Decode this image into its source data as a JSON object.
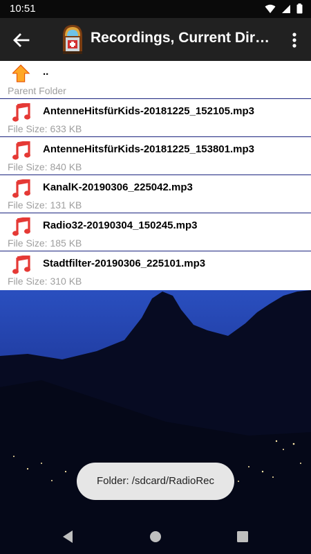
{
  "status": {
    "time": "10:51",
    "icons": [
      "wifi-icon",
      "signal-icon",
      "battery-icon"
    ]
  },
  "appbar": {
    "title": "Recordings, Current Dir:...",
    "back_icon": "arrow-back-icon",
    "app_icon": "jukebox-icon",
    "menu_icon": "more-vert-icon"
  },
  "parent": {
    "name": "..",
    "label": "Parent Folder",
    "icon": "up-arrow-icon"
  },
  "files": [
    {
      "name": "AntenneHitsfürKids-20181225_152105.mp3",
      "size": "File Size: 633 KB",
      "icon": "music-note-icon"
    },
    {
      "name": "AntenneHitsfürKids-20181225_153801.mp3",
      "size": "File Size: 840 KB",
      "icon": "music-note-icon"
    },
    {
      "name": "KanalK-20190306_225042.mp3",
      "size": "File Size: 131 KB",
      "icon": "music-note-icon"
    },
    {
      "name": "Radio32-20190304_150245.mp3",
      "size": "File Size: 185 KB",
      "icon": "music-note-icon"
    },
    {
      "name": "Stadtfilter-20190306_225101.mp3",
      "size": "File Size: 310 KB",
      "icon": "music-note-icon"
    }
  ],
  "toast": {
    "text": "Folder: /sdcard/RadioRec"
  },
  "colors": {
    "appbar": "#212121",
    "divider": "#1a237e",
    "note": "#e53935",
    "arrow": "#ff9800",
    "sky": "#1e3a9e"
  },
  "navbar": {
    "icons": [
      "nav-back-icon",
      "nav-home-icon",
      "nav-recents-icon"
    ]
  }
}
